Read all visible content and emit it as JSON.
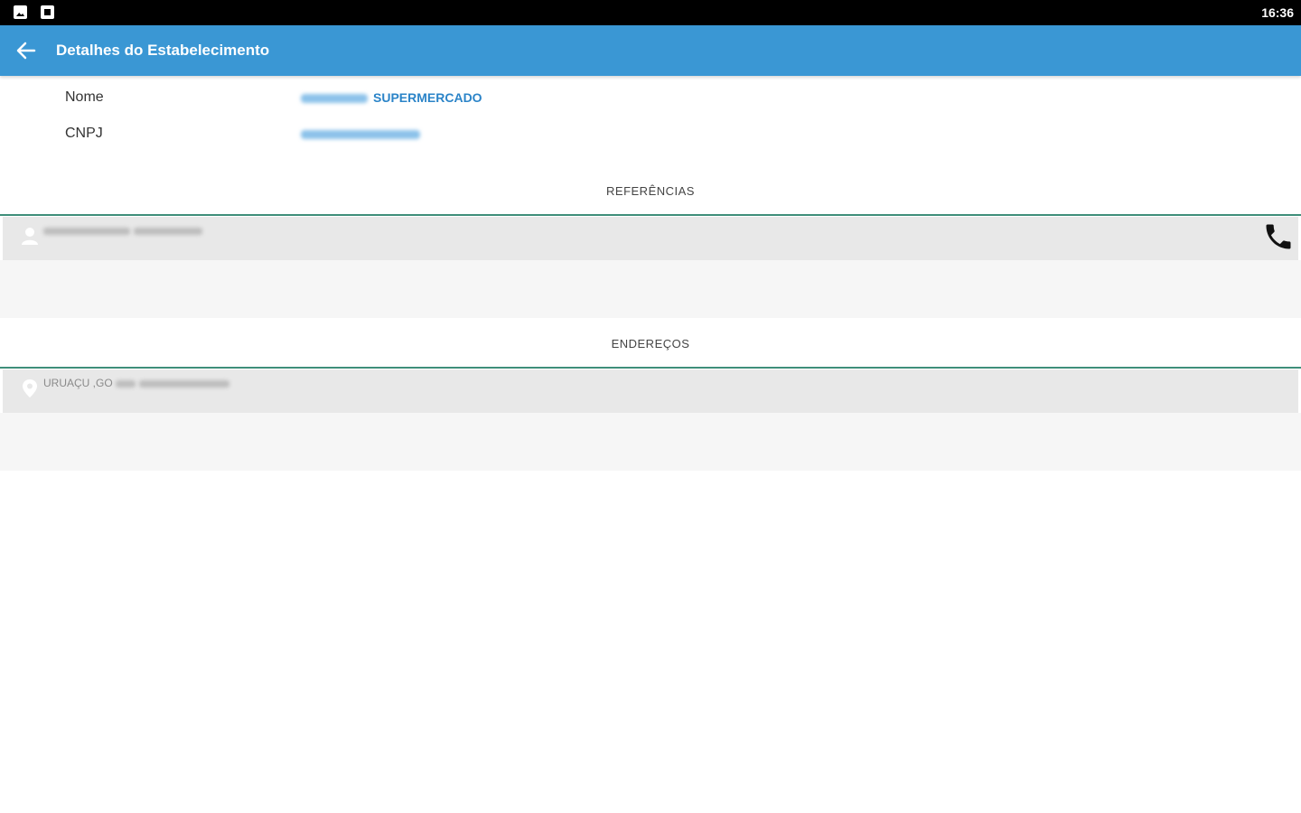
{
  "status_bar": {
    "time": "16:36",
    "icons": [
      "image-notification-icon",
      "square-notification-icon"
    ]
  },
  "app_bar": {
    "back_icon": "arrow-left-icon",
    "title": "Detalhes do Estabelecimento",
    "color": "#3a97d4"
  },
  "details": {
    "name_label": "Nome",
    "name_value": "SUPERMERCADO",
    "cnpj_label": "CNPJ",
    "value_color": "#2b84c8"
  },
  "sections": {
    "references": {
      "header": "REFERÊNCIAS",
      "item_icon": "person-icon",
      "action_icon": "phone-icon"
    },
    "addresses": {
      "header": "ENDEREÇOS",
      "item_icon": "location-pin-icon",
      "item_text": "URUAÇU ,GO"
    },
    "divider_color": "#3f8f7a"
  }
}
